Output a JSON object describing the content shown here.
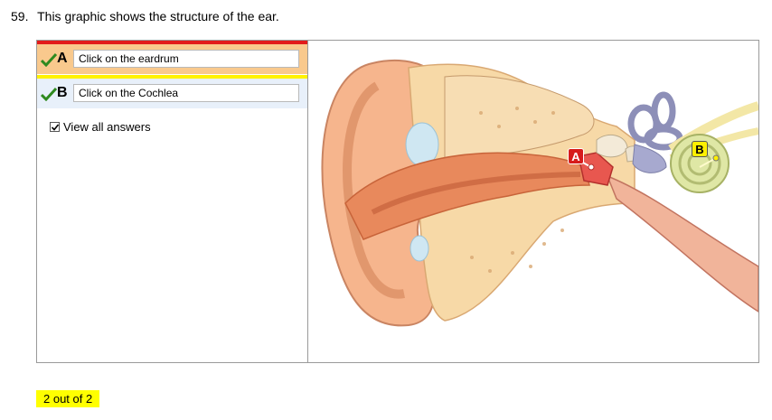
{
  "question": {
    "number": "59.",
    "text": "This graphic shows the structure of the ear."
  },
  "answers": [
    {
      "letter": "A",
      "text": "Click on the eardrum",
      "status": "correct",
      "color": "#e21b1b"
    },
    {
      "letter": "B",
      "text": "Click on the Cochlea",
      "status": "correct",
      "color": "#fff200"
    }
  ],
  "view_all": {
    "label": "View all answers",
    "checked": true
  },
  "diagram": {
    "markers": [
      {
        "letter": "A",
        "target": "eardrum",
        "color": "#d71b1b"
      },
      {
        "letter": "B",
        "target": "cochlea",
        "color": "#ffef00"
      }
    ]
  },
  "score": {
    "text": "2 out of 2"
  },
  "colors": {
    "correct_check": "#2f8a1f",
    "row_a_bg": "#f9c98d",
    "row_b_bg": "#e8f0fa",
    "score_bg": "#ffff00"
  }
}
